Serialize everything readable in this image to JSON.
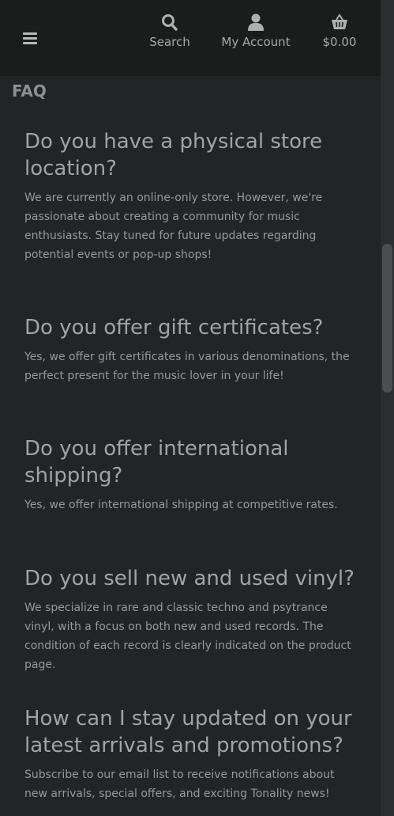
{
  "header": {
    "nav": {
      "search_label": "Search",
      "account_label": "My Account",
      "cart_label": "$0.00"
    },
    "icons": {
      "menu": "hamburger-menu-icon",
      "search": "search-icon",
      "account": "user-icon",
      "cart": "basket-icon"
    }
  },
  "faq": {
    "title": "FAQ",
    "items": [
      {
        "question": "Do you have a physical store location?",
        "answer": "We are currently an online-only store. However, we're passionate about creating a community for music enthusiasts. Stay tuned for future updates regarding potential events or pop-up shops!"
      },
      {
        "question": "Do you offer gift certificates?",
        "answer": "Yes, we offer gift certificates in various denominations, the perfect present for the music lover in your life!"
      },
      {
        "question": "Do you offer international shipping?",
        "answer": "Yes, we offer international shipping at competitive rates."
      },
      {
        "question": "Do you sell new and used vinyl?",
        "answer": "We specialize in rare and classic techno and psytrance vinyl, with a focus on both new and used records. The condition of each record is clearly indicated on the product page."
      },
      {
        "question": "How can I stay updated on your latest arrivals and promotions?",
        "answer": "Subscribe to our email list to receive notifications about new arrivals, special offers, and exciting Tonality news!"
      }
    ]
  },
  "colors": {
    "background": "#222425",
    "header_background": "#1b1c1c",
    "text": "#999999",
    "heading": "#a3a3a3"
  }
}
